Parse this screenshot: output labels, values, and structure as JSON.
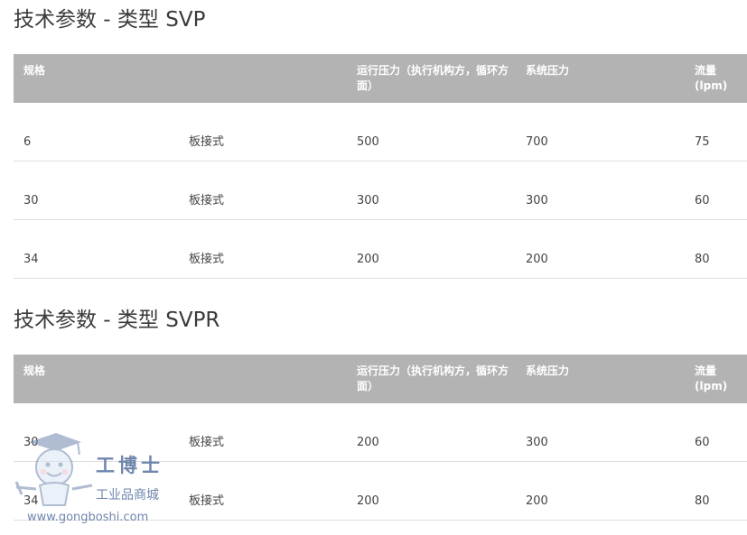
{
  "sections": [
    {
      "title": "技术参数 - 类型 SVP",
      "headers": [
        "规格",
        "",
        "运行压力（执行机构方，循环方面）",
        "系统压力",
        "流量 (lpm)"
      ],
      "rows": [
        [
          "6",
          "板接式",
          "500",
          "700",
          "75"
        ],
        [
          "30",
          "板接式",
          "300",
          "300",
          "60"
        ],
        [
          "34",
          "板接式",
          "200",
          "200",
          "80"
        ]
      ]
    },
    {
      "title": "技术参数 - 类型 SVPR",
      "headers": [
        "规格",
        "",
        "运行压力（执行机构方，循环方面）",
        "系统压力",
        "流量 (lpm)"
      ],
      "rows": [
        [
          "30",
          "板接式",
          "200",
          "300",
          "60"
        ],
        [
          "34",
          "板接式",
          "200",
          "200",
          "80"
        ]
      ]
    }
  ],
  "watermark": {
    "brand": "工博士",
    "subtitle": "工业品商城",
    "url": "www.gongboshi.com",
    "color": "#6f86ad"
  },
  "colors": {
    "header_bg": "#b3b3b3",
    "row_border": "#dedede",
    "text": "#444444"
  }
}
